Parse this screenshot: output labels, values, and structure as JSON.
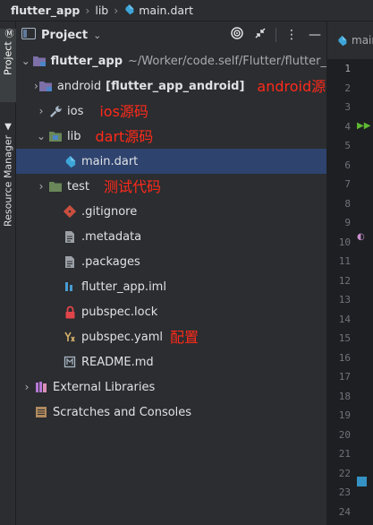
{
  "breadcrumb": {
    "root": "flutter_app",
    "folder": "lib",
    "file": "main.dart"
  },
  "side_tabs": {
    "project": "Project",
    "resource_manager": "Resource Manager"
  },
  "panel": {
    "title": "Project"
  },
  "tree": {
    "root": {
      "name": "flutter_app",
      "path": "~/Worker/code.self/Flutter/flutter_"
    },
    "android": {
      "name": "android",
      "module": "[flutter_app_android]",
      "annotation": "android源码"
    },
    "ios": {
      "name": "ios",
      "annotation": "ios源码"
    },
    "lib": {
      "name": "lib",
      "annotation": "dart源码"
    },
    "main": {
      "name": "main.dart"
    },
    "test": {
      "name": "test",
      "annotation": "测试代码"
    },
    "gitignore": {
      "name": ".gitignore"
    },
    "metadata": {
      "name": ".metadata"
    },
    "packages": {
      "name": ".packages"
    },
    "iml": {
      "name": "flutter_app.iml"
    },
    "lock": {
      "name": "pubspec.lock"
    },
    "yaml": {
      "name": "pubspec.yaml",
      "annotation": "配置"
    },
    "readme": {
      "name": "README.md"
    },
    "external": {
      "name": "External Libraries"
    },
    "scratches": {
      "name": "Scratches and Consoles"
    }
  },
  "editor": {
    "tab_label": "main",
    "line_numbers": [
      "1",
      "2",
      "3",
      "4",
      "5",
      "6",
      "7",
      "8",
      "9",
      "10",
      "11",
      "12",
      "13",
      "14",
      "15",
      "16",
      "17",
      "18",
      "19",
      "20",
      "21",
      "22",
      "23",
      "24"
    ]
  },
  "colors": {
    "annotation": "#ff2a1a",
    "selection": "#2e436e",
    "dart": "#3ea5d8",
    "android": "#3ddc84"
  }
}
